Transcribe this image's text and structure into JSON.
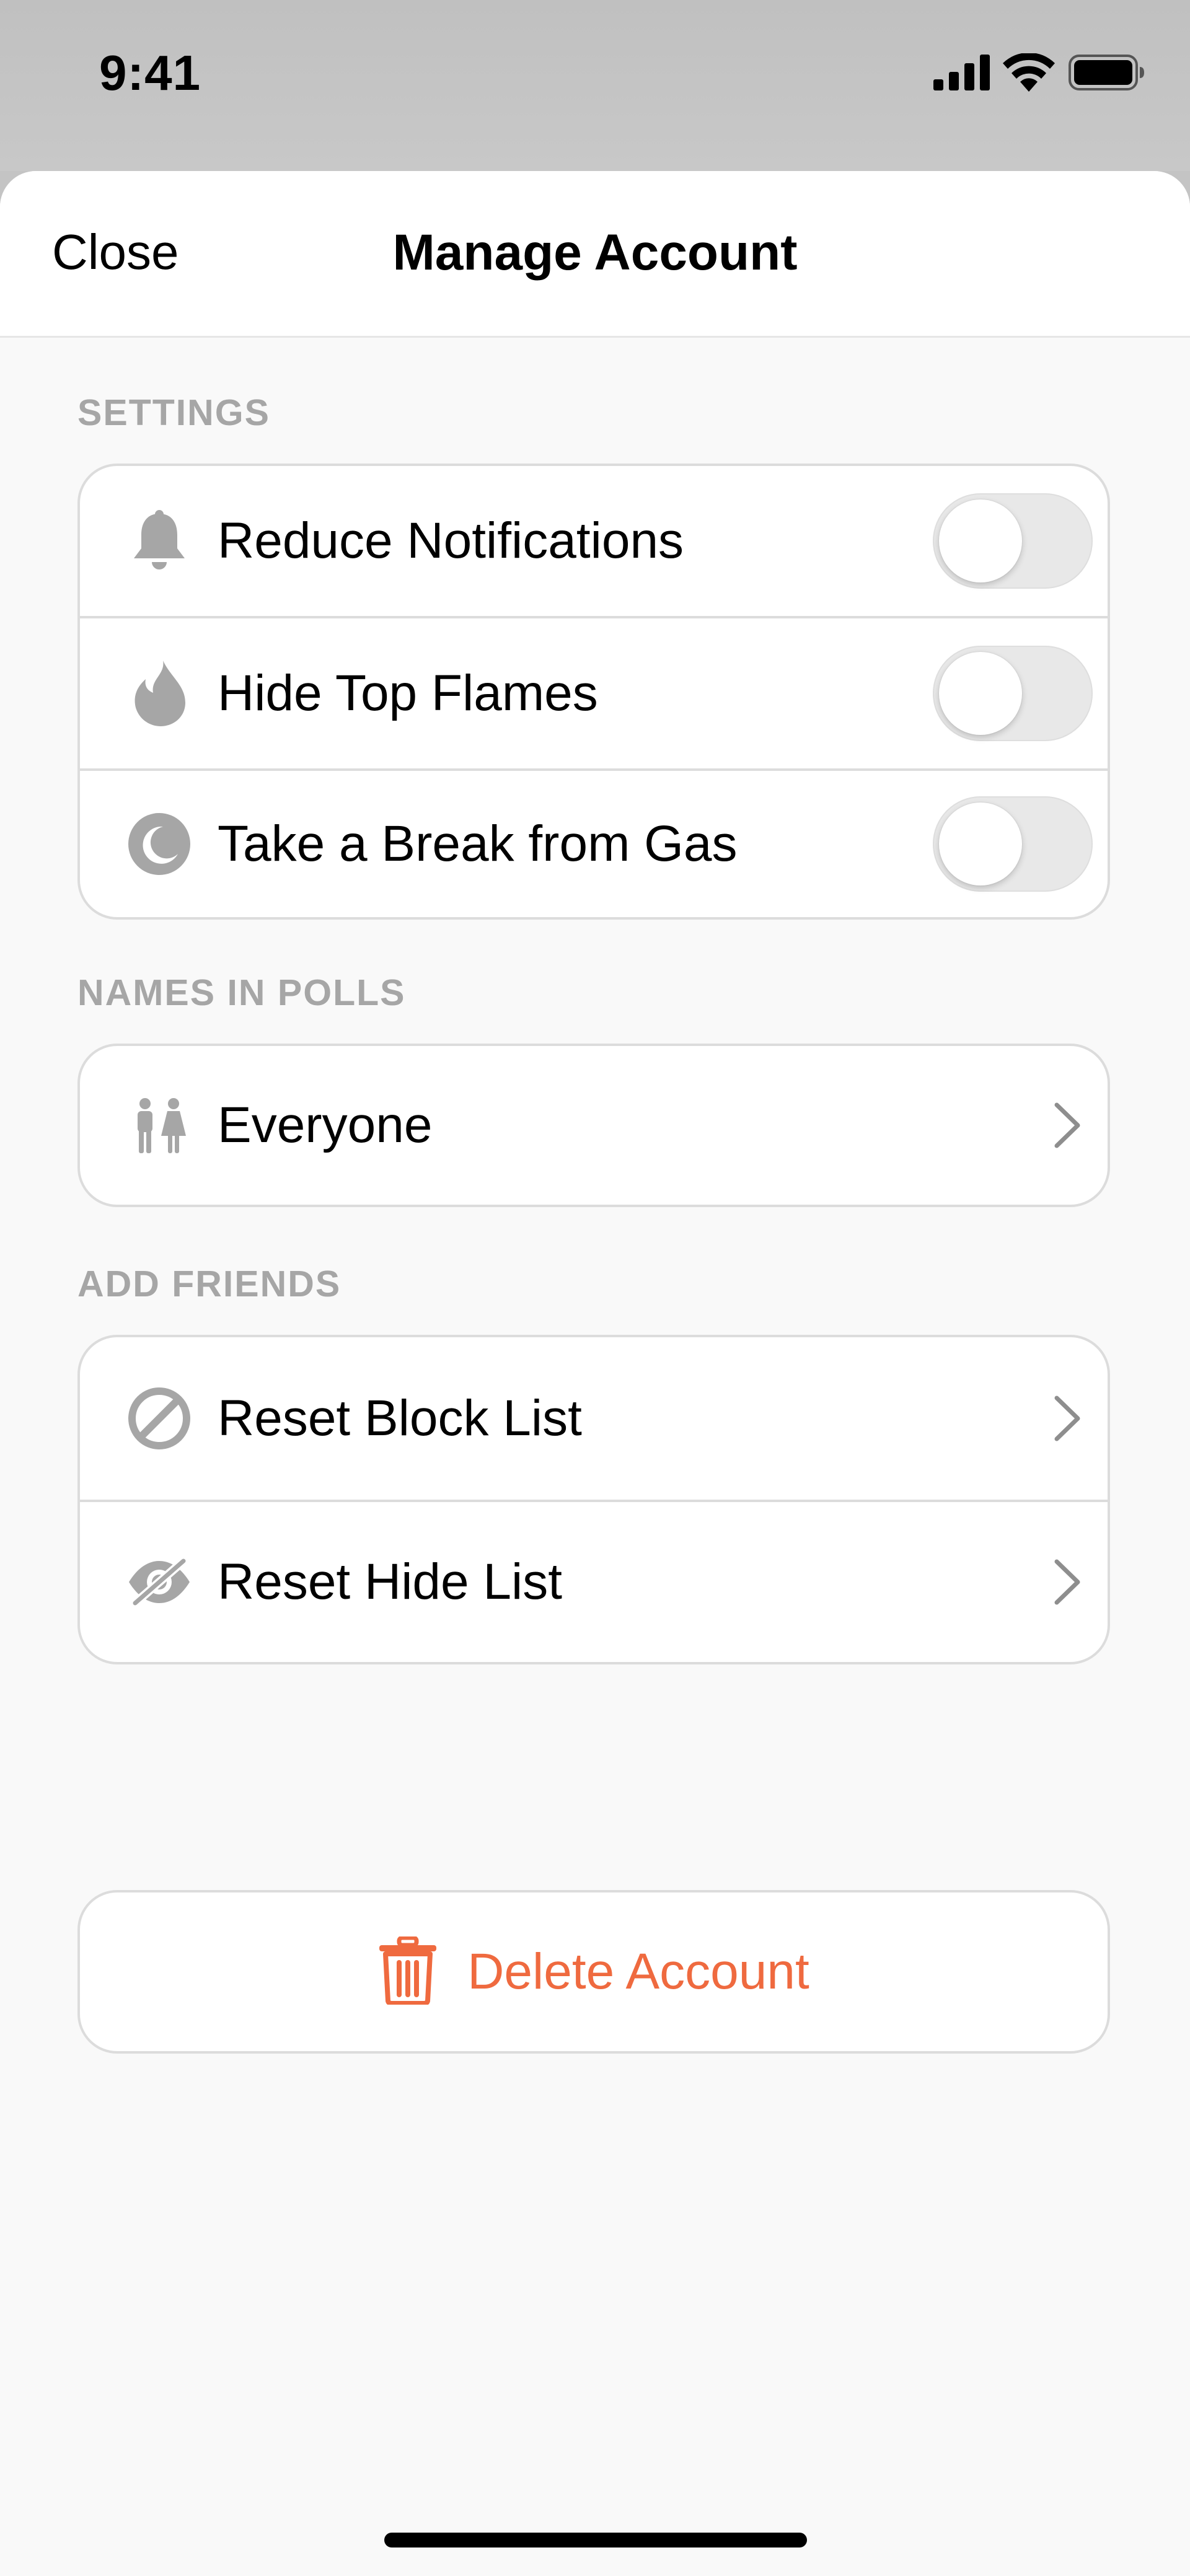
{
  "status_bar": {
    "time": "9:41",
    "icons": [
      "cellular-signal-icon",
      "wifi-icon",
      "battery-icon"
    ]
  },
  "nav": {
    "close_label": "Close",
    "title": "Manage Account"
  },
  "settings": {
    "header": "SETTINGS",
    "items": [
      {
        "label": "Reduce Notifications",
        "icon": "bell-icon",
        "enabled": false
      },
      {
        "label": "Hide Top Flames",
        "icon": "flame-icon",
        "enabled": false
      },
      {
        "label": "Take a Break from Gas",
        "icon": "moon-icon",
        "enabled": false
      }
    ]
  },
  "names_in_polls": {
    "header": "NAMES IN POLLS",
    "value": "Everyone",
    "icon": "people-icon"
  },
  "add_friends": {
    "header": "ADD FRIENDS",
    "items": [
      {
        "label": "Reset Block List",
        "icon": "block-icon"
      },
      {
        "label": "Reset Hide List",
        "icon": "eye-slash-icon"
      }
    ]
  },
  "delete_account": {
    "label": "Delete Account",
    "icon": "trash-icon"
  },
  "colors": {
    "accent_destructive": "#ef6a3f",
    "icon_gray": "#a6a6a6",
    "section_header": "#a6a6a6"
  }
}
